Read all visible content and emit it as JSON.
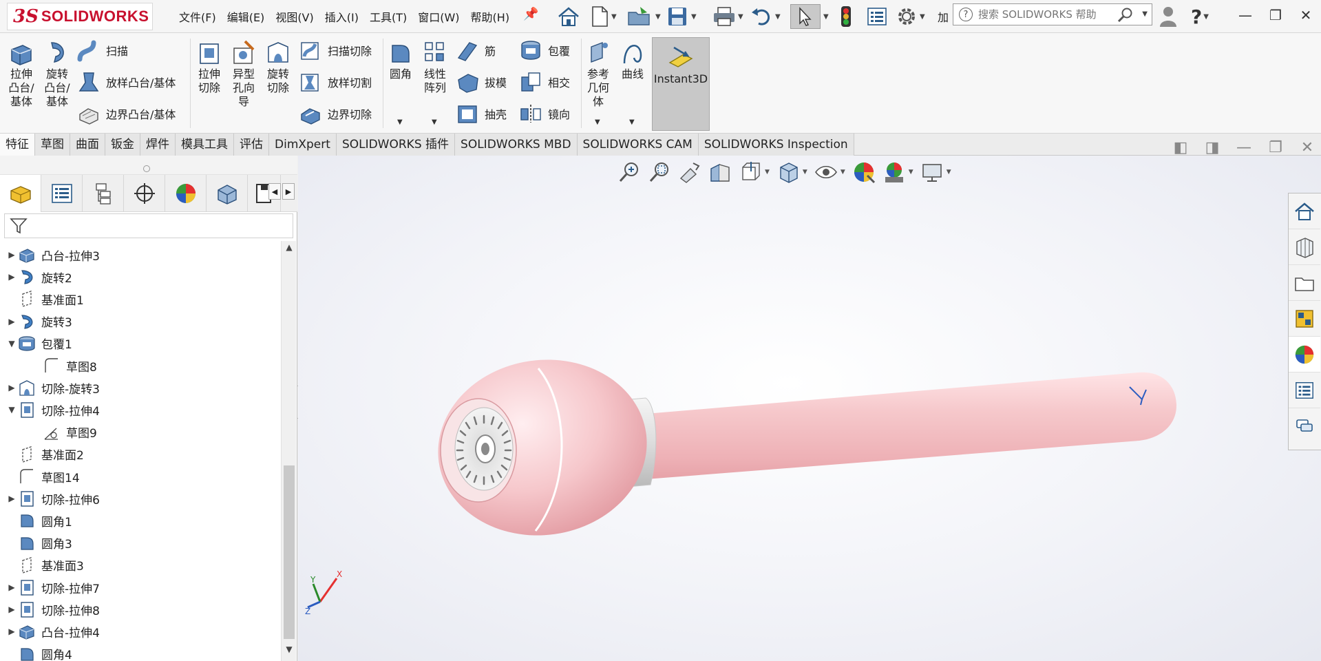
{
  "app": {
    "logo_ds": "3S",
    "logo_text": "SOLIDWORKS",
    "brand_color": "#c8102e"
  },
  "menu": [
    "文件(F)",
    "编辑(E)",
    "视图(V)",
    "插入(I)",
    "工具(T)",
    "窗口(W)",
    "帮助(H)"
  ],
  "toolbar": {
    "add_in_label": "加",
    "search_placeholder": "搜索 SOLIDWORKS 帮助",
    "help_label": "?"
  },
  "ribbon": {
    "extrude_boss": [
      "拉伸",
      "凸台/",
      "基体"
    ],
    "revolve_boss": [
      "旋转",
      "凸台/",
      "基体"
    ],
    "sweep": "扫描",
    "loft_boss": "放样凸台/基体",
    "boundary_boss": "边界凸台/基体",
    "extrude_cut": [
      "拉伸",
      "切除"
    ],
    "hole_wizard": [
      "异型",
      "孔向",
      "导"
    ],
    "revolve_cut": [
      "旋转",
      "切除"
    ],
    "swept_cut": "扫描切除",
    "lofted_cut": "放样切割",
    "boundary_cut": "边界切除",
    "fillet": "圆角",
    "linear_pattern": [
      "线性",
      "阵列"
    ],
    "rib": "筋",
    "draft": "拔模",
    "shell": "抽壳",
    "wrap": "包覆",
    "intersect": "相交",
    "mirror": "镜向",
    "ref_geometry": [
      "参考",
      "几何",
      "体"
    ],
    "curves": "曲线",
    "instant3d": "Instant3D"
  },
  "tabs": [
    "特征",
    "草图",
    "曲面",
    "钣金",
    "焊件",
    "模具工具",
    "评估",
    "DimXpert",
    "SOLIDWORKS 插件",
    "SOLIDWORKS MBD",
    "SOLIDWORKS CAM",
    "SOLIDWORKS Inspection"
  ],
  "tree": [
    {
      "label": "凸台-拉伸3",
      "icon": "extrude-boss-icon",
      "expander": "▶",
      "indent": 0
    },
    {
      "label": "旋转2",
      "icon": "revolve-icon",
      "expander": "▶",
      "indent": 0
    },
    {
      "label": "基准面1",
      "icon": "plane-icon",
      "expander": "",
      "indent": 0
    },
    {
      "label": "旋转3",
      "icon": "revolve-icon",
      "expander": "▶",
      "indent": 0
    },
    {
      "label": "包覆1",
      "icon": "wrap-icon",
      "expander": "▼",
      "indent": 0
    },
    {
      "label": "草图8",
      "icon": "sketch-icon",
      "expander": "",
      "indent": 1
    },
    {
      "label": "切除-旋转3",
      "icon": "revolve-cut-icon",
      "expander": "▶",
      "indent": 0
    },
    {
      "label": "切除-拉伸4",
      "icon": "extrude-cut-icon",
      "expander": "▼",
      "indent": 0
    },
    {
      "label": "草图9",
      "icon": "sketch-icon",
      "expander": "",
      "indent": 1
    },
    {
      "label": "基准面2",
      "icon": "plane-icon",
      "expander": "",
      "indent": 0
    },
    {
      "label": "草图14",
      "icon": "sketch-icon",
      "expander": "",
      "indent": 0
    },
    {
      "label": "切除-拉伸6",
      "icon": "extrude-cut-icon",
      "expander": "▶",
      "indent": 0
    },
    {
      "label": "圆角1",
      "icon": "fillet-icon",
      "expander": "",
      "indent": 0
    },
    {
      "label": "圆角3",
      "icon": "fillet-icon",
      "expander": "",
      "indent": 0
    },
    {
      "label": "基准面3",
      "icon": "plane-icon",
      "expander": "",
      "indent": 0
    },
    {
      "label": "切除-拉伸7",
      "icon": "extrude-cut-icon",
      "expander": "▶",
      "indent": 0
    },
    {
      "label": "切除-拉伸8",
      "icon": "extrude-cut-icon",
      "expander": "▶",
      "indent": 0
    },
    {
      "label": "凸台-拉伸4",
      "icon": "extrude-boss-icon",
      "expander": "▶",
      "indent": 0
    },
    {
      "label": "圆角4",
      "icon": "fillet-icon",
      "expander": "",
      "indent": 0
    }
  ],
  "triad": {
    "x": "X",
    "y": "Y",
    "z": "Z"
  },
  "colors": {
    "model": "#f6c9cc",
    "accent": "#2a6fb0"
  }
}
